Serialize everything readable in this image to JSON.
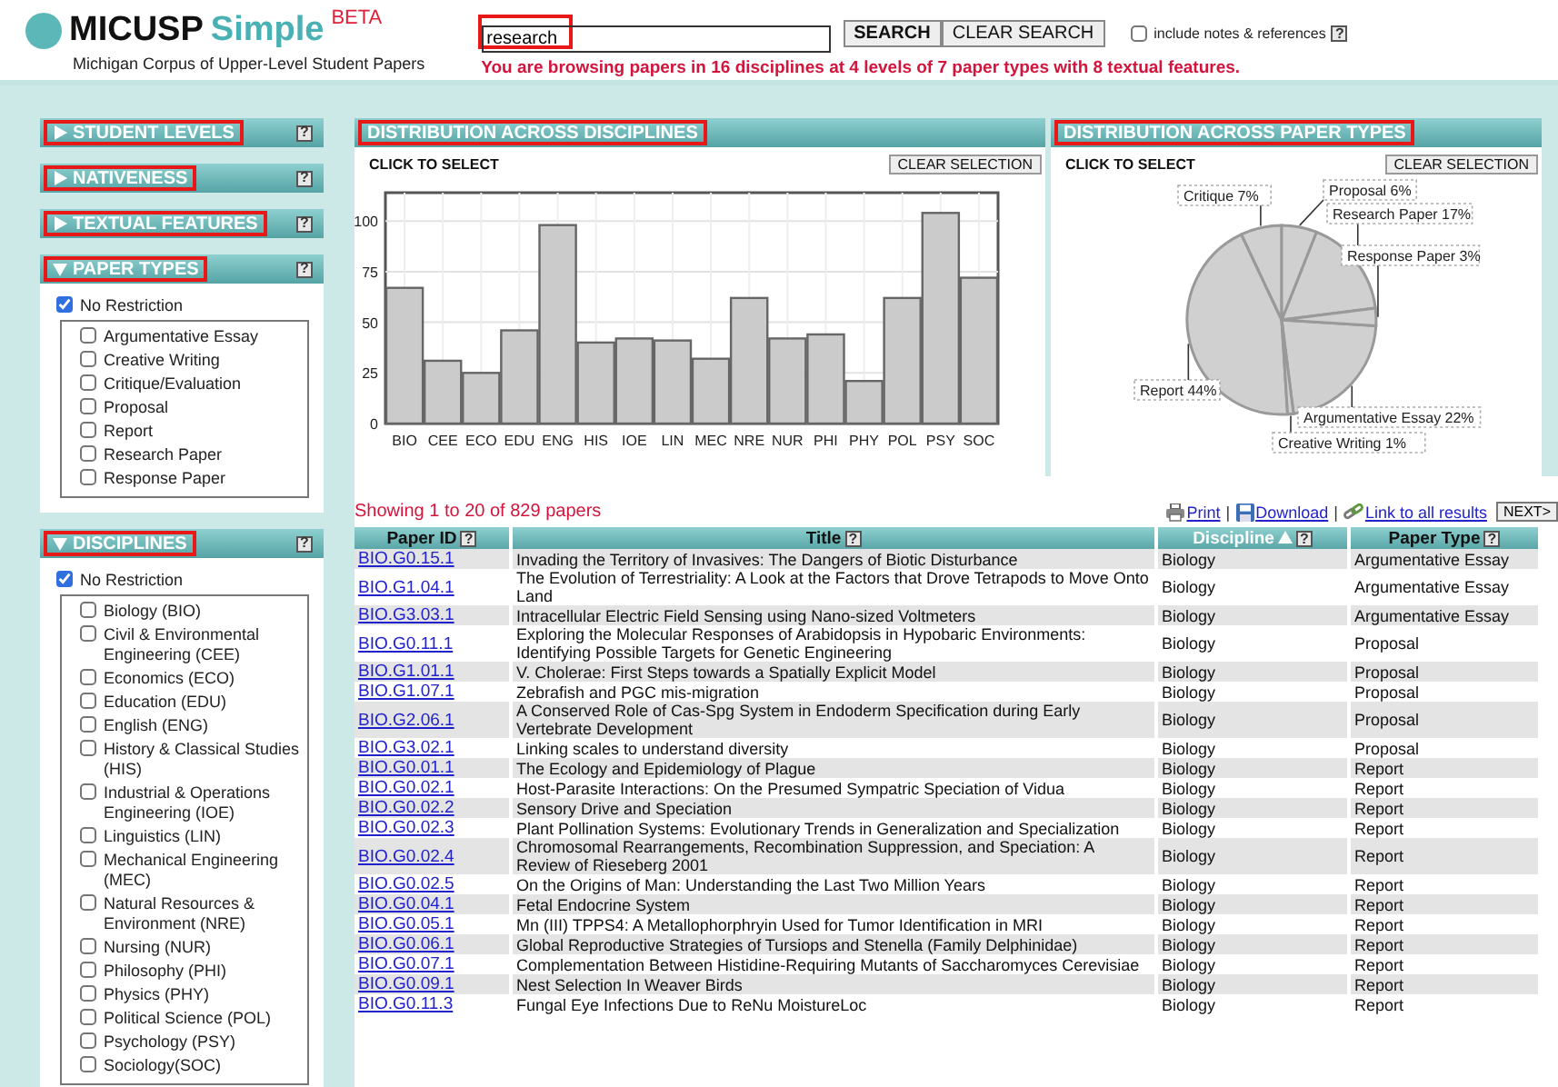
{
  "header": {
    "logo": {
      "name": "MICUSP",
      "accent": "Simple",
      "badge": "BETA"
    },
    "subtitle": "Michigan Corpus of Upper-Level Student Papers"
  },
  "search": {
    "value": "research",
    "highlighted": true,
    "buttons": [
      "SEARCH",
      "CLEAR SEARCH"
    ],
    "include_notes": {
      "label": "include notes & references",
      "checked": false,
      "help": "?"
    },
    "message": "You are browsing papers in 16 disciplines at 4 levels of 7 paper types with 8 textual features."
  },
  "sidebar": {
    "panels": [
      {
        "title": "STUDENT LEVELS",
        "expanded": false,
        "highlighted": true,
        "help": "?"
      },
      {
        "title": "NATIVENESS",
        "expanded": false,
        "highlighted": true,
        "help": "?"
      },
      {
        "title": "TEXTUAL FEATURES",
        "expanded": false,
        "highlighted": true,
        "help": "?"
      },
      {
        "title": "PAPER TYPES",
        "expanded": true,
        "highlighted": true,
        "help": "?",
        "no_restriction": {
          "label": "No Restriction",
          "checked": true
        },
        "options": [
          {
            "label": "Argumentative Essay",
            "checked": false
          },
          {
            "label": "Creative Writing",
            "checked": false
          },
          {
            "label": "Critique/Evaluation",
            "checked": false
          },
          {
            "label": "Proposal",
            "checked": false
          },
          {
            "label": "Report",
            "checked": false
          },
          {
            "label": "Research Paper",
            "checked": false
          },
          {
            "label": "Response Paper",
            "checked": false
          }
        ]
      },
      {
        "title": "DISCIPLINES",
        "expanded": true,
        "highlighted": true,
        "help": "?",
        "no_restriction": {
          "label": "No Restriction",
          "checked": true
        },
        "options": [
          {
            "label": "Biology (BIO)",
            "checked": false
          },
          {
            "label": "Civil & Environmental Engineering (CEE)",
            "checked": false
          },
          {
            "label": "Economics (ECO)",
            "checked": false
          },
          {
            "label": "Education (EDU)",
            "checked": false
          },
          {
            "label": "English (ENG)",
            "checked": false
          },
          {
            "label": "History & Classical Studies (HIS)",
            "checked": false
          },
          {
            "label": "Industrial & Operations Engineering (IOE)",
            "checked": false
          },
          {
            "label": "Linguistics (LIN)",
            "checked": false
          },
          {
            "label": "Mechanical Engineering (MEC)",
            "checked": false
          },
          {
            "label": "Natural Resources & Environment (NRE)",
            "checked": false
          },
          {
            "label": "Nursing (NUR)",
            "checked": false
          },
          {
            "label": "Philosophy (PHI)",
            "checked": false
          },
          {
            "label": "Physics (PHY)",
            "checked": false
          },
          {
            "label": "Political Science (POL)",
            "checked": false
          },
          {
            "label": "Psychology (PSY)",
            "checked": false
          },
          {
            "label": "Sociology(SOC)",
            "checked": false
          }
        ]
      }
    ]
  },
  "charts": [
    {
      "title": "DISTRIBUTION ACROSS DISCIPLINES",
      "highlighted": true,
      "hint": "CLICK TO SELECT",
      "clear_button": "CLEAR SELECTION",
      "chart_data": {
        "type": "bar",
        "categories": [
          "BIO",
          "CEE",
          "ECO",
          "EDU",
          "ENG",
          "HIS",
          "IOE",
          "LIN",
          "MEC",
          "NRE",
          "NUR",
          "PHI",
          "PHY",
          "POL",
          "PSY",
          "SOC"
        ],
        "values": [
          67,
          31,
          25,
          46,
          98,
          40,
          42,
          41,
          32,
          62,
          42,
          44,
          21,
          62,
          104,
          72
        ],
        "ylim": [
          0,
          114
        ],
        "yticks": [
          0,
          25,
          50,
          75,
          100
        ],
        "grid": true
      }
    },
    {
      "title": "DISTRIBUTION ACROSS PAPER TYPES",
      "highlighted": true,
      "hint": "CLICK TO SELECT",
      "clear_button": "CLEAR SELECTION",
      "chart_data": {
        "type": "pie",
        "categories": [
          "Proposal",
          "Research Paper",
          "Response Paper",
          "Argumentative Essay",
          "Creative Writing",
          "Report",
          "Critique"
        ],
        "values": [
          6,
          17,
          3,
          22,
          1,
          44,
          7
        ],
        "data_labels": true,
        "value_labels": [
          "6%",
          "17%",
          "3%",
          "22%",
          "1%",
          "44%",
          "7%"
        ]
      }
    }
  ],
  "results": {
    "summary": "Showing 1 to 20 of 829 papers",
    "links": [
      "Print",
      "Download",
      "Link to all results"
    ],
    "separator": "|",
    "next_button": "NEXT>"
  },
  "table": {
    "columns": [
      {
        "label": "Paper ID",
        "help": "?",
        "sorted": false
      },
      {
        "label": "Title",
        "help": "?",
        "sorted": false
      },
      {
        "label": "Discipline",
        "help": "?",
        "sorted": true
      },
      {
        "label": "Paper Type",
        "help": "?",
        "sorted": false
      }
    ],
    "rows": [
      [
        "BIO.G0.15.1",
        "Invading the Territory of Invasives: The Dangers of Biotic Disturbance",
        "Biology",
        "Argumentative Essay"
      ],
      [
        "BIO.G1.04.1",
        "The Evolution of Terrestriality: A Look at the Factors that Drove Tetrapods to Move Onto Land",
        "Biology",
        "Argumentative Essay"
      ],
      [
        "BIO.G3.03.1",
        "Intracellular Electric Field Sensing using Nano-sized Voltmeters",
        "Biology",
        "Argumentative Essay"
      ],
      [
        "BIO.G0.11.1",
        "Exploring the Molecular Responses of Arabidopsis in Hypobaric Environments: Identifying Possible Targets for Genetic Engineering",
        "Biology",
        "Proposal"
      ],
      [
        "BIO.G1.01.1",
        "V. Cholerae: First Steps towards a Spatially Explicit Model",
        "Biology",
        "Proposal"
      ],
      [
        "BIO.G1.07.1",
        "Zebrafish and PGC mis-migration",
        "Biology",
        "Proposal"
      ],
      [
        "BIO.G2.06.1",
        "A Conserved Role of Cas-Spg System in Endoderm Specification during Early Vertebrate Development",
        "Biology",
        "Proposal"
      ],
      [
        "BIO.G3.02.1",
        "Linking scales to understand diversity",
        "Biology",
        "Proposal"
      ],
      [
        "BIO.G0.01.1",
        "The Ecology and Epidemiology of Plague",
        "Biology",
        "Report"
      ],
      [
        "BIO.G0.02.1",
        "Host-Parasite Interactions: On the Presumed Sympatric Speciation of Vidua",
        "Biology",
        "Report"
      ],
      [
        "BIO.G0.02.2",
        "Sensory Drive and Speciation",
        "Biology",
        "Report"
      ],
      [
        "BIO.G0.02.3",
        "Plant Pollination Systems: Evolutionary Trends in Generalization and Specialization",
        "Biology",
        "Report"
      ],
      [
        "BIO.G0.02.4",
        "Chromosomal Rearrangements, Recombination Suppression, and Speciation: A Review of Rieseberg 2001",
        "Biology",
        "Report"
      ],
      [
        "BIO.G0.02.5",
        "On the Origins of Man: Understanding the Last Two Million Years",
        "Biology",
        "Report"
      ],
      [
        "BIO.G0.04.1",
        "Fetal Endocrine System",
        "Biology",
        "Report"
      ],
      [
        "BIO.G0.05.1",
        "Mn (III) TPPS4: A Metallophorphryin Used for Tumor Identification in MRI",
        "Biology",
        "Report"
      ],
      [
        "BIO.G0.06.1",
        "Global Reproductive Strategies of Tursiops and Stenella (Family Delphinidae)",
        "Biology",
        "Report"
      ],
      [
        "BIO.G0.07.1",
        "Complementation Between Histidine-Requiring Mutants of Saccharomyces Cerevisiae",
        "Biology",
        "Report"
      ],
      [
        "BIO.G0.09.1",
        "Nest Selection In Weaver Birds",
        "Biology",
        "Report"
      ],
      [
        "BIO.G0.11.3",
        "Fungal Eye Infections Due to ReNu MoistureLoc",
        "Biology",
        "Report"
      ]
    ]
  }
}
